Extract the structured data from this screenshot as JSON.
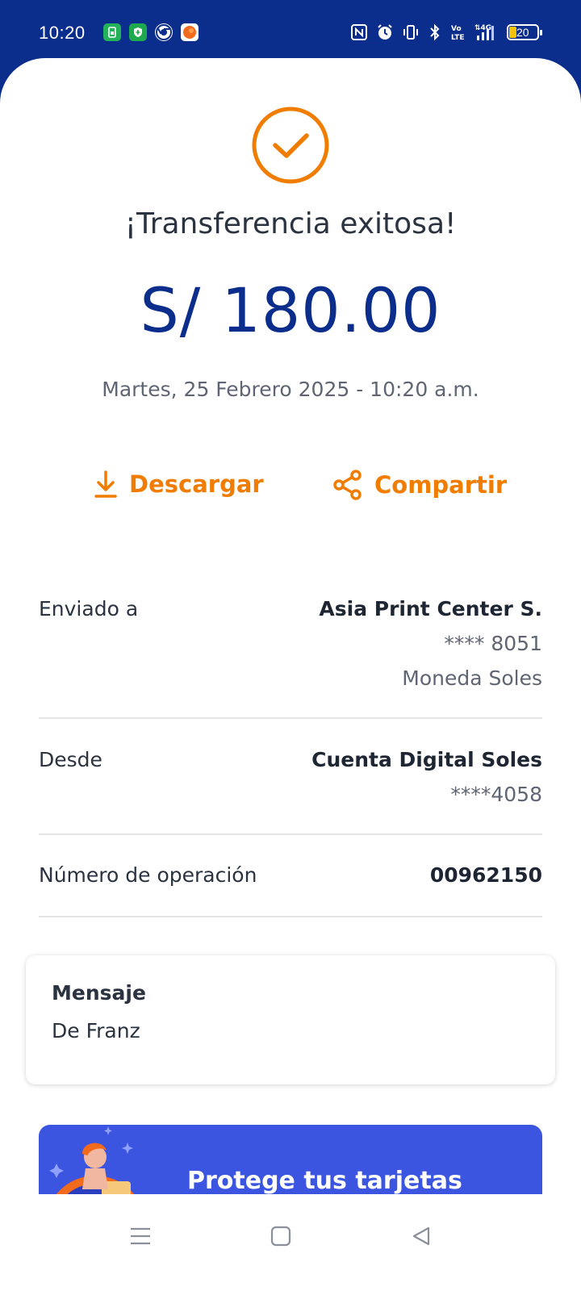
{
  "status_bar": {
    "time": "10:20",
    "battery_level": "20",
    "icons": [
      "app-green-icon",
      "shield-app-icon",
      "chrome-icon",
      "orange-app-icon",
      "nfc-icon",
      "alarm-icon",
      "vibrate-icon",
      "bluetooth-icon",
      "volte-icon",
      "signal-4g-icon",
      "battery-icon"
    ]
  },
  "colors": {
    "brand_blue": "#0b2e8c",
    "accent_orange": "#f07c00",
    "promo_blue": "#3b55e0"
  },
  "receipt": {
    "title": "¡Transferencia exitosa!",
    "amount": "S/ 180.00",
    "datetime": "Martes, 25 Febrero 2025 - 10:20 a.m."
  },
  "actions": {
    "download_label": "Descargar",
    "share_label": "Compartir"
  },
  "details": {
    "sent_to": {
      "label": "Enviado a",
      "name": "Asia Print Center S.",
      "account": "**** 8051",
      "currency": "Moneda Soles"
    },
    "from": {
      "label": "Desde",
      "name": "Cuenta Digital Soles",
      "account": "****4058"
    },
    "operation": {
      "label": "Número de operación",
      "number": "00962150"
    }
  },
  "message": {
    "title": "Mensaje",
    "body": "De Franz"
  },
  "promo": {
    "text": "Protege tus tarjetas"
  },
  "nav": {
    "icons": [
      "recents-icon",
      "home-icon",
      "back-icon"
    ]
  }
}
